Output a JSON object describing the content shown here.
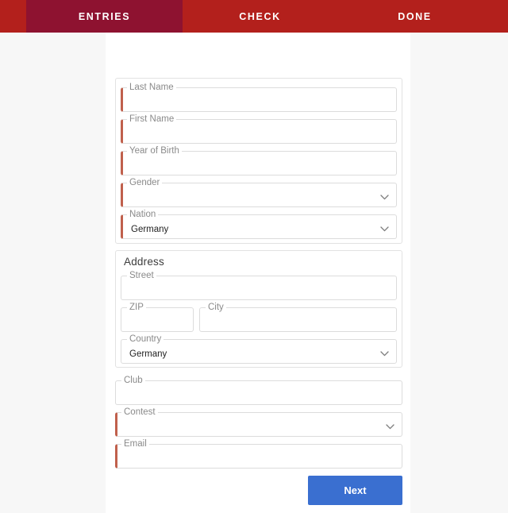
{
  "tabs": [
    {
      "label": "ENTRIES",
      "active": true
    },
    {
      "label": "CHECK",
      "active": false
    },
    {
      "label": "DONE",
      "active": false
    }
  ],
  "colors": {
    "header_red": "#b3201c",
    "active_tab_red": "#8e1230",
    "required_accent": "#c0604c",
    "primary_button_blue": "#3a6fd0",
    "page_background": "#f7f7f7",
    "card_background": "#ffffff",
    "field_border": "#dcdcdc",
    "label_text": "#8a8a8a"
  },
  "form": {
    "personal": {
      "fields": [
        {
          "label": "Last Name",
          "value": "",
          "type": "text",
          "required": true
        },
        {
          "label": "First Name",
          "value": "",
          "type": "text",
          "required": true
        },
        {
          "label": "Year of Birth",
          "value": "",
          "type": "text",
          "required": true
        },
        {
          "label": "Gender",
          "value": "",
          "type": "select",
          "required": true
        },
        {
          "label": "Nation",
          "value": "Germany",
          "type": "select",
          "required": true
        }
      ]
    },
    "address": {
      "title": "Address",
      "fields": [
        {
          "label": "Street",
          "value": "",
          "type": "text",
          "required": false
        },
        {
          "label": "ZIP",
          "value": "",
          "type": "text",
          "required": false
        },
        {
          "label": "City",
          "value": "",
          "type": "text",
          "required": false
        },
        {
          "label": "Country",
          "value": "Germany",
          "type": "select",
          "required": false
        }
      ]
    },
    "other": {
      "fields": [
        {
          "label": "Club",
          "value": "",
          "type": "text",
          "required": false
        },
        {
          "label": "Contest",
          "value": "",
          "type": "select",
          "required": true
        },
        {
          "label": "Email",
          "value": "",
          "type": "text",
          "required": true
        }
      ]
    }
  },
  "actions": {
    "next_label": "Next"
  },
  "icons": {
    "dropdown": "chevron-down-icon"
  }
}
